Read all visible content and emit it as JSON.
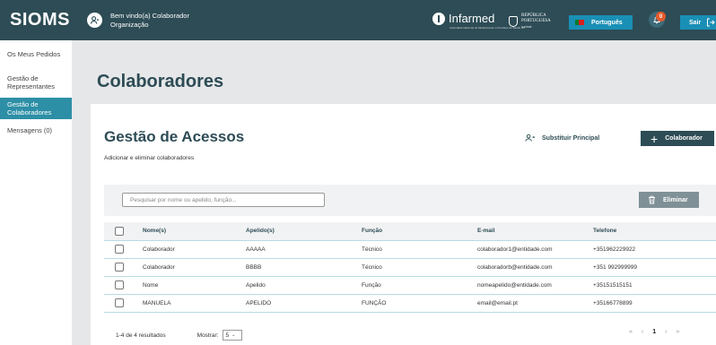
{
  "header": {
    "logo": "SIOMS",
    "welcome_line1": "Bem vindo(a) Colaborador",
    "welcome_line2": "Organização",
    "infarmed": "Infarmed",
    "infarmed_sub": "Autoridade Nacional do Medicamento e Produtos de Saúde I.P.",
    "republica_line1": "REPÚBLICA",
    "republica_line2": "PORTUGUESA",
    "republica_line3": "SAÚDE",
    "language": "Português",
    "notifications": "0",
    "logout": "Sair"
  },
  "sidebar": {
    "items": [
      {
        "label": "Os Meus Pedidos"
      },
      {
        "label": "Gestão de Representantes"
      },
      {
        "label": "Gestão de Colaboradores"
      },
      {
        "label": "Mensagens (0)"
      }
    ]
  },
  "page": {
    "title": "Colaboradores"
  },
  "card": {
    "title": "Gestão de Acessos",
    "subtitle": "Adicionar e eliminar colaboradores",
    "replace_label": "Substituir Principal",
    "add_label": "Colaborador",
    "search_placeholder": "Pesquisar por nome ou apelido, função...",
    "delete_label": "Eliminar"
  },
  "table": {
    "headers": [
      "Nome(s)",
      "Apelido(s)",
      "Função",
      "E-mail",
      "Telefone"
    ],
    "rows": [
      [
        "Colaborador",
        "AAAAA",
        "Técnico",
        "colaborador1@entidade.com",
        "+351962229922"
      ],
      [
        "Colaborador",
        "BBBB",
        "Técnico",
        "colaboradorb@entidade.com",
        "+351 992999999"
      ],
      [
        "Nome",
        "Apelido",
        "Função",
        "nomeapelido@entidade.com",
        "+35151515151"
      ],
      [
        "MANUELA",
        "APELIDO",
        "FUNÇÃO",
        "email@email.pt",
        "+35166778899"
      ]
    ]
  },
  "footer": {
    "results": "1-4 de 4 resultados",
    "show_label": "Mostrar:",
    "show_value": "5",
    "pager": {
      "first": "«",
      "prev": "‹",
      "current": "1",
      "next": "›",
      "last": "»"
    }
  },
  "colors": {
    "primary": "#2d4c55",
    "accent": "#1a8fb5",
    "active": "#2d8fa6",
    "badge": "#e55a2b"
  }
}
